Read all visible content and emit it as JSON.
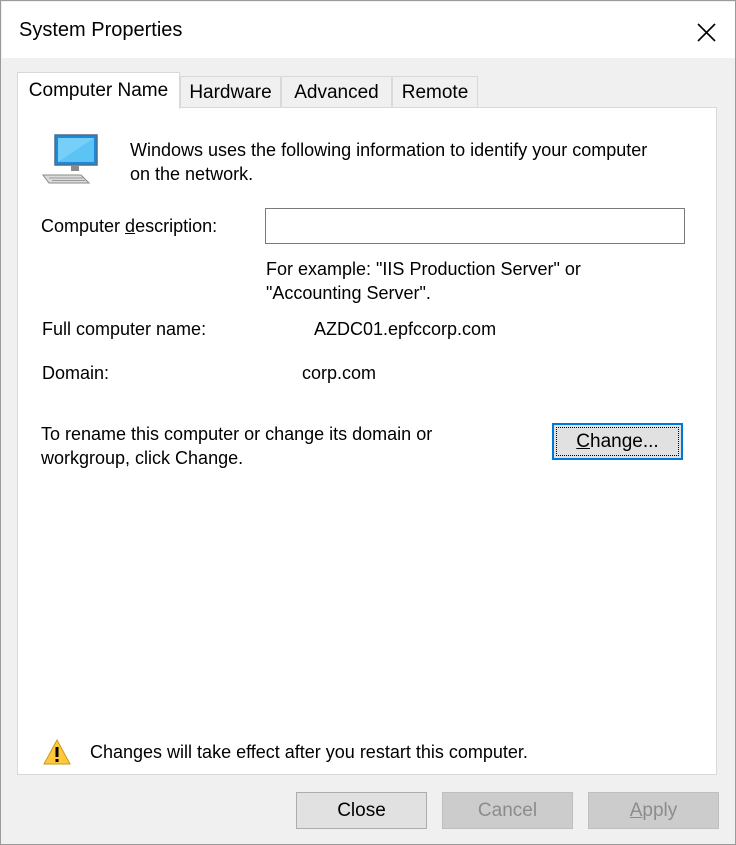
{
  "window": {
    "title": "System Properties"
  },
  "tabs": [
    {
      "label": "Computer Name",
      "active": true
    },
    {
      "label": "Hardware",
      "active": false
    },
    {
      "label": "Advanced",
      "active": false
    },
    {
      "label": "Remote",
      "active": false
    }
  ],
  "computer_name": {
    "intro_line1": "Windows uses the following information to identify your computer",
    "intro_line2": "on the network.",
    "description_label_pre": "Computer ",
    "description_label_key": "d",
    "description_label_post": "escription:",
    "description_value": "",
    "example_line1": "For example: \"IIS Production Server\" or",
    "example_line2": "\"Accounting Server\".",
    "full_name_label": "Full computer name:",
    "full_name_value": "AZDC01.epfccorp.com",
    "domain_label": "Domain:",
    "domain_value": "corp.com",
    "rename_line1": "To rename this computer or change its domain or",
    "rename_line2": "workgroup, click Change.",
    "change_button_key": "C",
    "change_button_rest": "hange...",
    "warning_text": "Changes will take effect after you restart this computer."
  },
  "footer": {
    "close_label": "Close",
    "cancel_label": "Cancel",
    "apply_key": "A",
    "apply_rest": "pply"
  },
  "icons": {
    "computer": "computer-icon",
    "warning": "warning-icon",
    "close": "close-icon"
  },
  "colors": {
    "accent": "#0078d7",
    "warning": "#ffc83d"
  }
}
